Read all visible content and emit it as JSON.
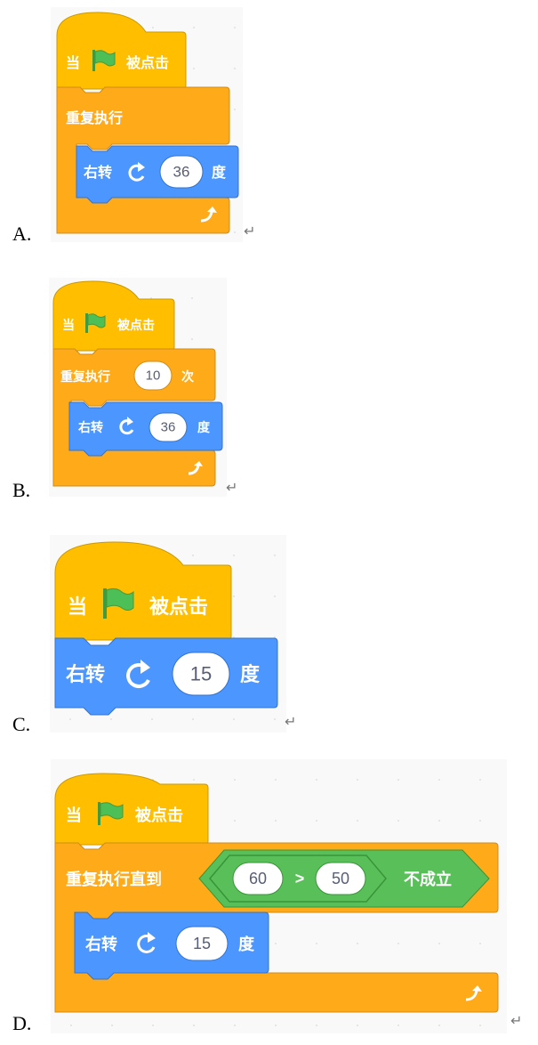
{
  "return_mark": "↵",
  "options": [
    {
      "letter": "A.",
      "hat_label": "当",
      "hat_suffix": "被点击",
      "loop_label": "重复执行",
      "turn_label": "右转",
      "turn_value": "36",
      "turn_unit": "度"
    },
    {
      "letter": "B.",
      "hat_label": "当",
      "hat_suffix": "被点击",
      "loop_label": "重复执行",
      "loop_count": "10",
      "loop_unit": "次",
      "turn_label": "右转",
      "turn_value": "36",
      "turn_unit": "度"
    },
    {
      "letter": "C.",
      "hat_label": "当",
      "hat_suffix": "被点击",
      "turn_label": "右转",
      "turn_value": "15",
      "turn_unit": "度"
    },
    {
      "letter": "D.",
      "hat_label": "当",
      "hat_suffix": "被点击",
      "loop_label": "重复执行直到",
      "cond_left": "60",
      "cond_op": ">",
      "cond_right": "50",
      "cond_suffix": "不成立",
      "turn_label": "右转",
      "turn_value": "15",
      "turn_unit": "度"
    }
  ],
  "colors": {
    "hat": "#ffbf00",
    "control": "#ffab19",
    "motion": "#4c97ff",
    "operator": "#59c059",
    "flag": "#4cbf56"
  }
}
